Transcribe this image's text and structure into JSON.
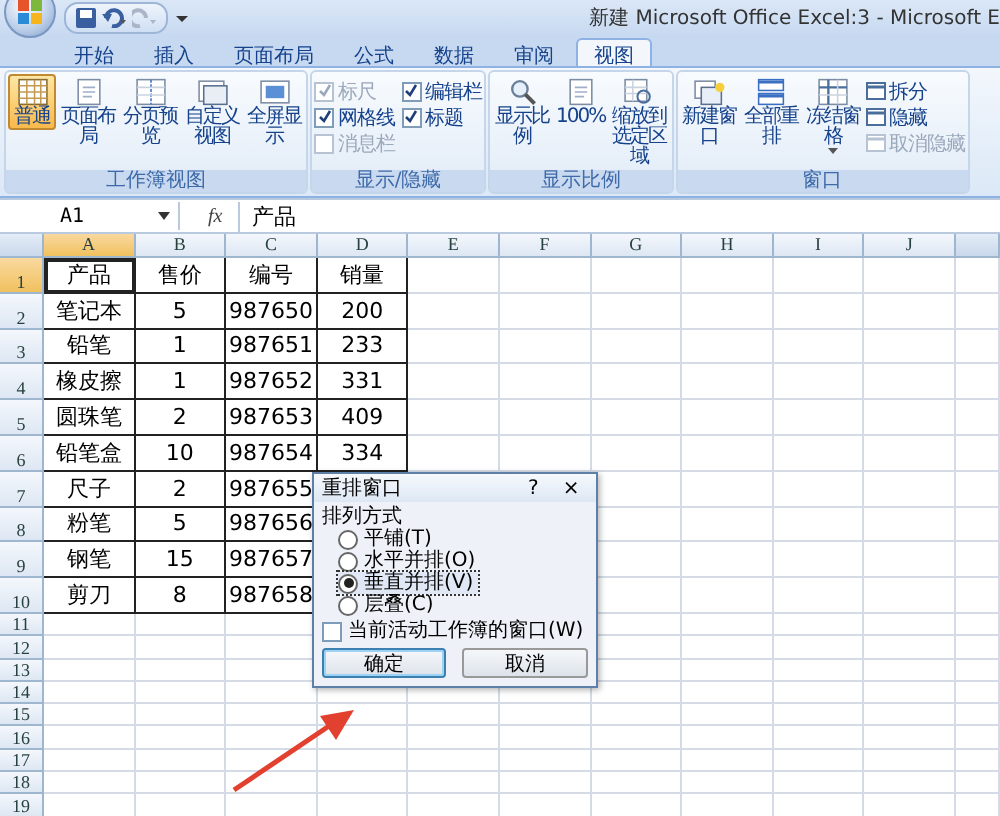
{
  "title_bar": {
    "title": "新建 Microsoft Office Excel:3 - Microsoft E"
  },
  "ribbon_tabs": [
    {
      "label": "开始",
      "selected": false
    },
    {
      "label": "插入",
      "selected": false
    },
    {
      "label": "页面布局",
      "selected": false
    },
    {
      "label": "公式",
      "selected": false
    },
    {
      "label": "数据",
      "selected": false
    },
    {
      "label": "审阅",
      "selected": false
    },
    {
      "label": "视图",
      "selected": true
    }
  ],
  "ribbon_groups": [
    {
      "label": "工作簿视图",
      "items": [
        {
          "kind": "large",
          "label": "普通",
          "selected": true
        },
        {
          "kind": "large",
          "label": "页面布局",
          "selected": false
        },
        {
          "kind": "large",
          "label": "分页预览",
          "selected": false
        },
        {
          "kind": "large",
          "label": "自定义视图",
          "selected": false
        },
        {
          "kind": "large",
          "label": "全屏显示",
          "selected": false
        }
      ]
    },
    {
      "label": "显示/隐藏",
      "items": [
        {
          "kind": "check",
          "label": "标尺",
          "checked": true,
          "disabled": true
        },
        {
          "kind": "check",
          "label": "网格线",
          "checked": true,
          "disabled": false
        },
        {
          "kind": "check",
          "label": "消息栏",
          "checked": false,
          "disabled": true
        },
        {
          "kind": "check",
          "label": "编辑栏",
          "checked": true,
          "disabled": false
        },
        {
          "kind": "check",
          "label": "标题",
          "checked": true,
          "disabled": false
        }
      ]
    },
    {
      "label": "显示比例",
      "items": [
        {
          "kind": "large",
          "label": "显示比例",
          "selected": false
        },
        {
          "kind": "large",
          "label": "100%",
          "selected": false
        },
        {
          "kind": "large",
          "label": "缩放到选定区域",
          "selected": false
        }
      ]
    },
    {
      "label": "窗口",
      "items": [
        {
          "kind": "large",
          "label": "新建窗口",
          "selected": false
        },
        {
          "kind": "large",
          "label": "全部重排",
          "selected": false
        },
        {
          "kind": "large",
          "label": "冻结窗格",
          "selected": false,
          "dropdown": true
        },
        {
          "kind": "small",
          "label": "拆分",
          "disabled": false
        },
        {
          "kind": "small",
          "label": "隐藏",
          "disabled": false
        },
        {
          "kind": "small",
          "label": "取消隐藏",
          "disabled": true
        }
      ]
    }
  ],
  "formula_bar": {
    "name_box": "A1",
    "function_button": "fx",
    "formula": "产品"
  },
  "sheet": {
    "columns": [
      {
        "label": "A",
        "selected": true
      },
      {
        "label": "B",
        "selected": false
      },
      {
        "label": "C",
        "selected": false
      },
      {
        "label": "D",
        "selected": false
      },
      {
        "label": "E",
        "selected": false
      },
      {
        "label": "F",
        "selected": false
      },
      {
        "label": "G",
        "selected": false
      },
      {
        "label": "H",
        "selected": false
      },
      {
        "label": "I",
        "selected": false
      },
      {
        "label": "J",
        "selected": false
      }
    ],
    "rows": [
      {
        "label": "1",
        "selected": true,
        "cells": [
          "产品",
          "售价",
          "编号",
          "销量"
        ]
      },
      {
        "label": "2",
        "selected": false,
        "cells": [
          "笔记本",
          "5",
          "987650",
          "200"
        ]
      },
      {
        "label": "3",
        "selected": false,
        "cells": [
          "铅笔",
          "1",
          "987651",
          "233"
        ]
      },
      {
        "label": "4",
        "selected": false,
        "cells": [
          "橡皮擦",
          "1",
          "987652",
          "331"
        ]
      },
      {
        "label": "5",
        "selected": false,
        "cells": [
          "圆珠笔",
          "2",
          "987653",
          "409"
        ]
      },
      {
        "label": "6",
        "selected": false,
        "cells": [
          "铅笔盒",
          "10",
          "987654",
          "334"
        ]
      },
      {
        "label": "7",
        "selected": false,
        "cells": [
          "尺子",
          "2",
          "987655"
        ]
      },
      {
        "label": "8",
        "selected": false,
        "cells": [
          "粉笔",
          "5",
          "987656"
        ]
      },
      {
        "label": "9",
        "selected": false,
        "cells": [
          "钢笔",
          "15",
          "987657"
        ]
      },
      {
        "label": "10",
        "selected": false,
        "cells": [
          "剪刀",
          "8",
          "987658"
        ]
      },
      {
        "label": "11",
        "selected": false
      },
      {
        "label": "12",
        "selected": false
      },
      {
        "label": "13",
        "selected": false
      },
      {
        "label": "14",
        "selected": false
      },
      {
        "label": "15",
        "selected": false
      },
      {
        "label": "16",
        "selected": false
      },
      {
        "label": "17",
        "selected": false
      },
      {
        "label": "18",
        "selected": false
      },
      {
        "label": "19",
        "selected": false
      }
    ]
  },
  "dialog": {
    "title": "重排窗口",
    "help": "?",
    "close": "×",
    "group_label": "排列方式",
    "options": [
      {
        "label": "平铺(T)",
        "selected": false
      },
      {
        "label": "水平并排(O)",
        "selected": false
      },
      {
        "label": "垂直并排(V)",
        "selected": true
      },
      {
        "label": "层叠(C)",
        "selected": false
      }
    ],
    "checkbox": {
      "label": "当前活动工作簿的窗口(W)",
      "checked": false
    },
    "buttons": [
      {
        "label": "确定",
        "default": true
      },
      {
        "label": "取消",
        "default": false
      }
    ]
  }
}
